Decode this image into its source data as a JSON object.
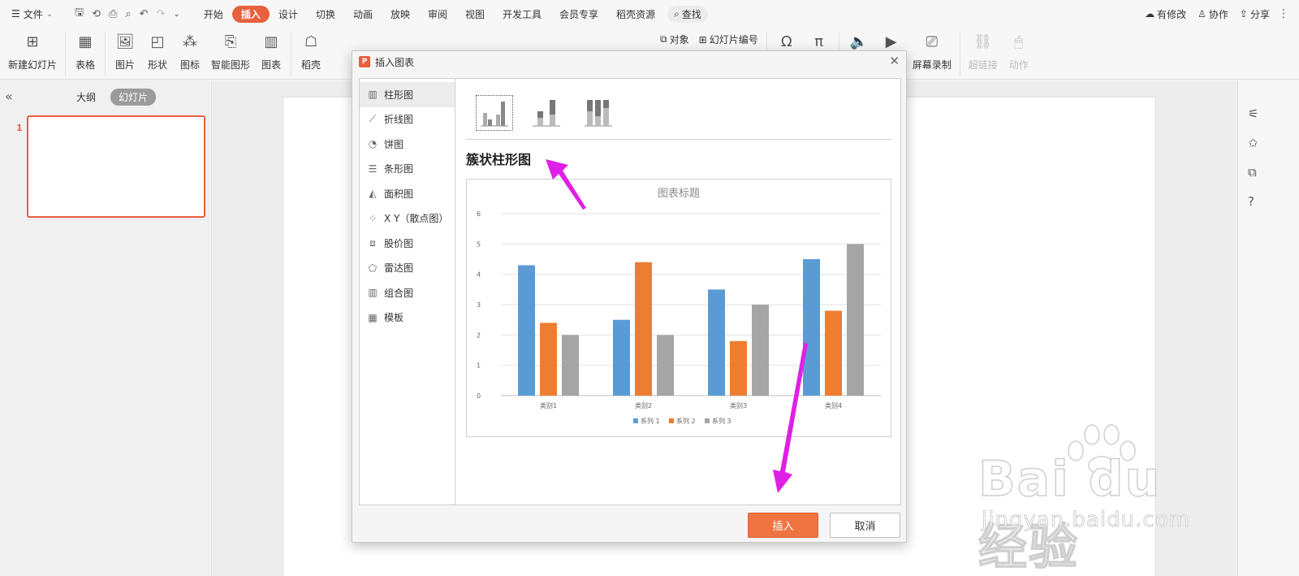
{
  "menubar": {
    "file_label": "文件",
    "tabs": [
      "开始",
      "插入",
      "设计",
      "切换",
      "动画",
      "放映",
      "审阅",
      "视图",
      "开发工具",
      "会员专享",
      "稻壳资源"
    ],
    "active_tab": "插入",
    "search_label": "查找",
    "right_items": [
      "有修改",
      "协作",
      "分享"
    ]
  },
  "ribbon": {
    "buttons": {
      "new_slide": "新建幻灯片",
      "table": "表格",
      "picture": "图片",
      "shape": "形状",
      "icon": "图标",
      "smartart": "智能图形",
      "chart": "图表",
      "docer": "稻壳",
      "audio": "音频",
      "video": "视频",
      "screen_record": "屏幕录制",
      "hyperlink": "超链接",
      "action": "动作"
    },
    "small": {
      "object": "对象",
      "slide_number": "幻灯片编号"
    }
  },
  "leftpanel": {
    "tabs": [
      "大纲",
      "幻灯片"
    ],
    "active_tab": "幻灯片",
    "slide_number": "1"
  },
  "dialog": {
    "title": "插入图表",
    "chart_types": [
      "柱形图",
      "折线图",
      "饼图",
      "条形图",
      "面积图",
      "X Y（散点图）",
      "股价图",
      "雷达图",
      "组合图",
      "模板"
    ],
    "active_type": "柱形图",
    "subtype_name": "簇状柱形图",
    "insert_label": "插入",
    "cancel_label": "取消"
  },
  "chart_data": {
    "type": "bar",
    "title": "图表标题",
    "categories": [
      "类别1",
      "类别2",
      "类别3",
      "类别4"
    ],
    "series": [
      {
        "name": "系列 1",
        "values": [
          4.3,
          2.5,
          3.5,
          4.5
        ],
        "color": "#5b9bd5"
      },
      {
        "name": "系列 2",
        "values": [
          2.4,
          4.4,
          1.8,
          2.8
        ],
        "color": "#ed7d31"
      },
      {
        "name": "系列 3",
        "values": [
          2.0,
          2.0,
          3.0,
          5.0
        ],
        "color": "#a5a5a5"
      }
    ],
    "ylim": [
      0,
      6
    ],
    "yticks": [
      0,
      1,
      2,
      3,
      4,
      5,
      6
    ],
    "grid": true,
    "legend": "bottom"
  },
  "watermark": {
    "brand": "Bai du 经验",
    "site": "jingyan.baidu.com"
  },
  "colors": {
    "accent": "#e8603d",
    "annotation": "#e020e6"
  }
}
